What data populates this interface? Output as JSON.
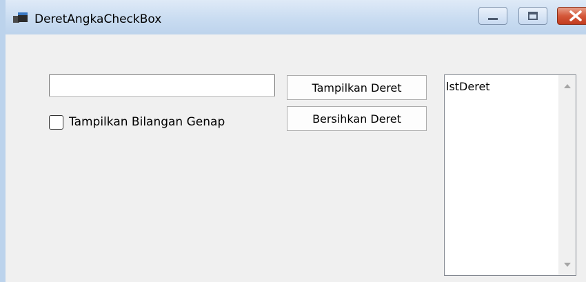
{
  "window": {
    "title": "DeretAngkaCheckBox"
  },
  "form": {
    "textbox_value": "",
    "checkbox_label": "Tampilkan Bilangan Genap",
    "checkbox_checked": false,
    "show_button_label": "Tampilkan Deret",
    "clear_button_label": "Bersihkan Deret",
    "listbox_items": [
      "lstDeret"
    ]
  },
  "icons": {
    "app": "app-window-icon",
    "minimize": "minimize-icon",
    "maximize": "maximize-icon",
    "close": "close-icon",
    "scroll_up": "scroll-up-arrow-icon",
    "scroll_down": "scroll-down-arrow-icon"
  },
  "colors": {
    "titlebar": "#c9dcf1",
    "close_button": "#c94a2c",
    "client_background": "#f0f0f0"
  }
}
